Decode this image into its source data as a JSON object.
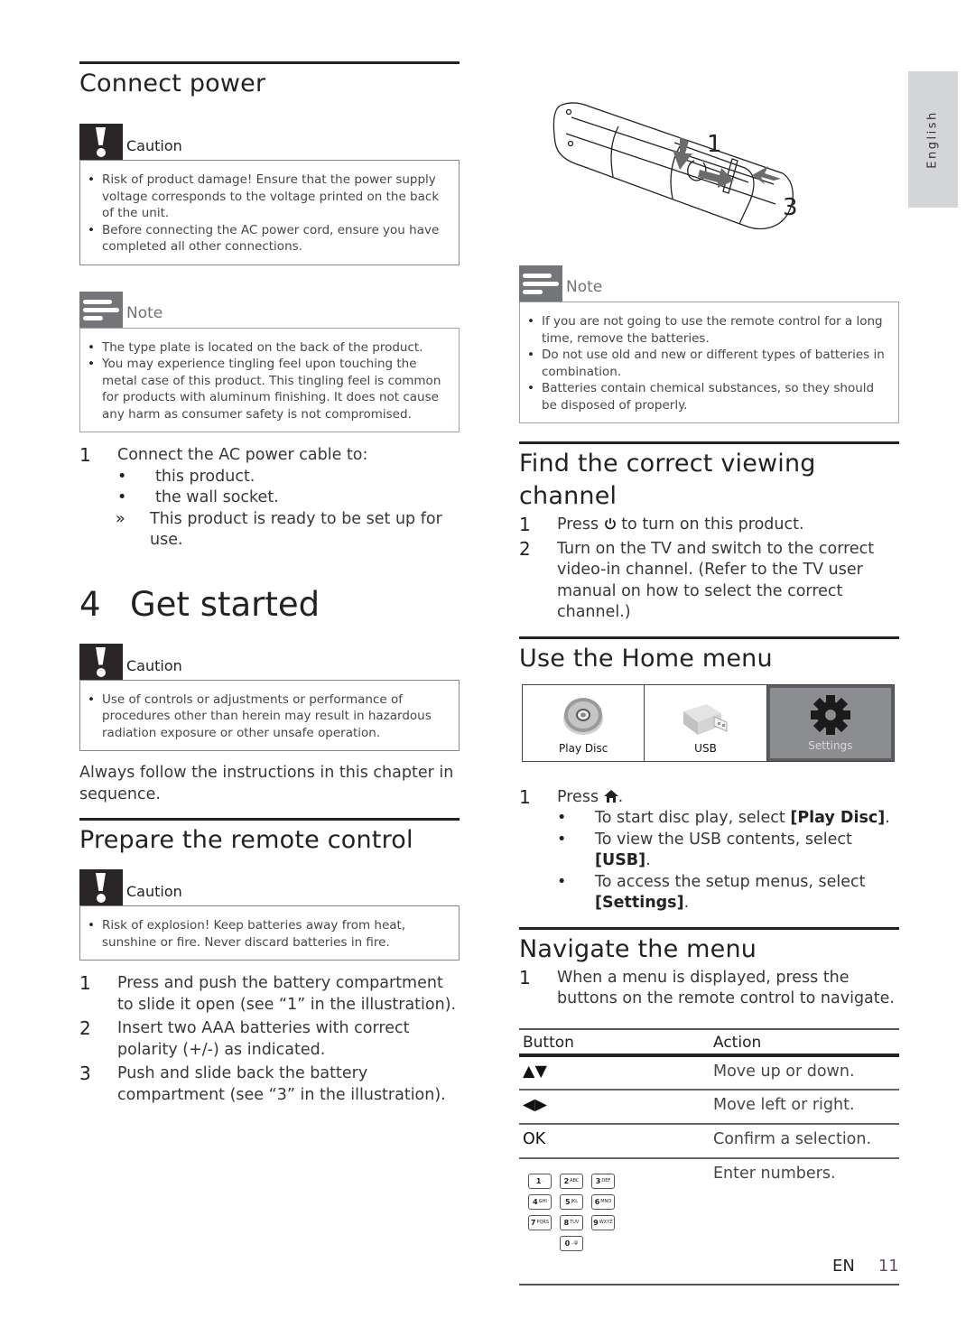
{
  "language_tab": "English",
  "left_column": {
    "connect_power": {
      "heading": "Connect power",
      "caution": {
        "title": "Caution",
        "items": [
          "Risk of product damage! Ensure that the power supply voltage corresponds to the voltage printed on the back of the unit.",
          "Before connecting the AC power cord, ensure you have completed all other connections."
        ]
      },
      "note": {
        "title": "Note",
        "items": [
          "The type plate is located on the back of the product.",
          "You may experience tingling feel upon touching the metal case of this product. This tingling feel is common for products with aluminum finishing. It does not cause any harm as consumer safety is not compromised."
        ]
      },
      "steps": [
        {
          "num": "1",
          "text": "Connect the AC power cable to:",
          "subitems": [
            {
              "bullet": "•",
              "text": "this product."
            },
            {
              "bullet": "•",
              "text": "the wall socket."
            },
            {
              "bullet": "»",
              "text": "This product is ready to be set up for use."
            }
          ]
        }
      ]
    },
    "chapter": {
      "number": "4",
      "title": "Get started",
      "caution": {
        "title": "Caution",
        "items": [
          "Use of controls or adjustments or performance of procedures other than herein may result in hazardous radiation exposure or other unsafe operation."
        ]
      },
      "intro": "Always follow the instructions in this chapter in sequence."
    },
    "prepare_remote": {
      "heading": "Prepare the remote control",
      "caution": {
        "title": "Caution",
        "items": [
          "Risk of explosion! Keep batteries away from heat, sunshine or fire. Never discard batteries in fire."
        ]
      },
      "steps": [
        {
          "num": "1",
          "text": "Press and push the battery compartment to slide it open (see “1” in the illustration)."
        },
        {
          "num": "2",
          "text": "Insert two AAA batteries with correct polarity (+/-) as indicated."
        },
        {
          "num": "3",
          "text": "Push and slide back the battery compartment (see “3” in the illustration)."
        }
      ]
    }
  },
  "right_column": {
    "illustration": {
      "callout_1": "1",
      "callout_3": "3"
    },
    "battery_note": {
      "title": "Note",
      "items": [
        "If you are not going to use the remote control for a long time, remove the batteries.",
        "Do not use old and new or different types of batteries in combination.",
        "Batteries contain chemical substances, so they should be disposed of properly."
      ]
    },
    "find_channel": {
      "heading": "Find the correct viewing channel",
      "steps": [
        {
          "num": "1",
          "pre": "Press ",
          "icon": "power-icon",
          "post": " to turn on this product."
        },
        {
          "num": "2",
          "text": "Turn on the TV and switch to the correct video-in channel. (Refer to the TV user manual on how to select the correct channel.)"
        }
      ]
    },
    "home_menu": {
      "heading": "Use the Home menu",
      "tiles": [
        {
          "label": "Play Disc",
          "icon": "disc-icon",
          "selected": false
        },
        {
          "label": "USB",
          "icon": "usb-drive-icon",
          "selected": false
        },
        {
          "label": "Settings",
          "icon": "gear-icon",
          "selected": true
        }
      ],
      "step": {
        "num": "1",
        "pre": "Press ",
        "icon": "home-icon",
        "post": "."
      },
      "subitems": [
        {
          "bullet": "•",
          "text": "To start disc play, select ",
          "bold": "[Play Disc]",
          "end": "."
        },
        {
          "bullet": "•",
          "text": "To view the USB contents, select ",
          "bold": "[USB]",
          "end": "."
        },
        {
          "bullet": "•",
          "text": "To access the setup menus, select ",
          "bold": "[Settings]",
          "end": "."
        }
      ]
    },
    "navigate_menu": {
      "heading": "Navigate the menu",
      "step": {
        "num": "1",
        "text": "When a menu is displayed, press the buttons on the remote control to navigate."
      },
      "table": {
        "headers": [
          "Button",
          "Action"
        ],
        "rows": [
          {
            "button": "▲▼",
            "action": "Move up or down."
          },
          {
            "button": "◀▶",
            "action": "Move left or right."
          },
          {
            "button": "OK",
            "action": "Confirm a selection."
          },
          {
            "button": "",
            "action": "Enter numbers."
          }
        ],
        "keypad": [
          {
            "digit": "1",
            "letters": "."
          },
          {
            "digit": "2",
            "letters": "ABC"
          },
          {
            "digit": "3",
            "letters": "DEF"
          },
          {
            "digit": "4",
            "letters": "GHI"
          },
          {
            "digit": "5",
            "letters": "JKL"
          },
          {
            "digit": "6",
            "letters": "MNO"
          },
          {
            "digit": "7",
            "letters": "PQRS"
          },
          {
            "digit": "8",
            "letters": "TUV"
          },
          {
            "digit": "9",
            "letters": "WXYZ"
          },
          {
            "digit": "0",
            "letters": "..@"
          }
        ]
      }
    }
  },
  "footer": {
    "lang_code": "EN",
    "page_number": "11"
  }
}
